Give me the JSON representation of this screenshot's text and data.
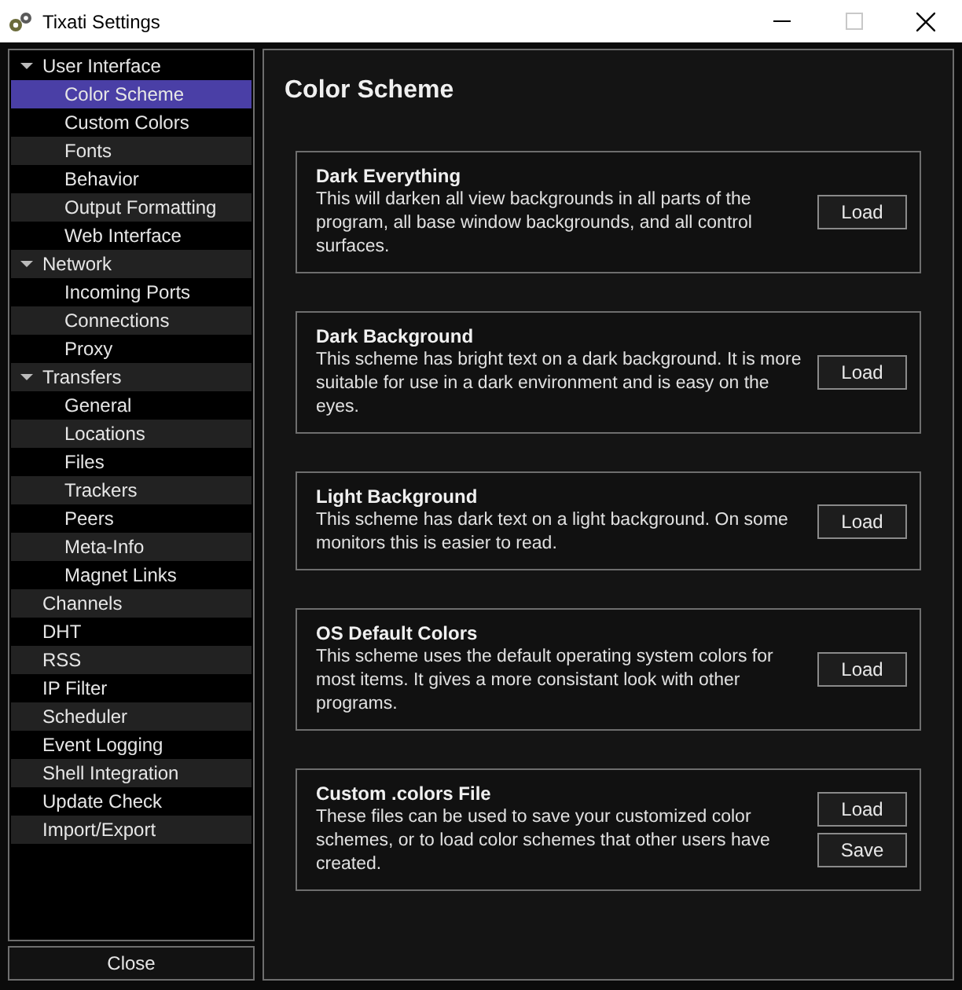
{
  "window": {
    "title": "Tixati Settings"
  },
  "sidebar": {
    "items": [
      {
        "label": "User Interface",
        "expanded": true,
        "selected": false,
        "children": [
          {
            "label": "Color Scheme",
            "selected": true
          },
          {
            "label": "Custom Colors",
            "selected": false
          },
          {
            "label": "Fonts",
            "selected": false
          },
          {
            "label": "Behavior",
            "selected": false
          },
          {
            "label": "Output Formatting",
            "selected": false
          },
          {
            "label": "Web Interface",
            "selected": false
          }
        ]
      },
      {
        "label": "Network",
        "expanded": true,
        "selected": false,
        "children": [
          {
            "label": "Incoming Ports",
            "selected": false
          },
          {
            "label": "Connections",
            "selected": false
          },
          {
            "label": "Proxy",
            "selected": false
          }
        ]
      },
      {
        "label": "Transfers",
        "expanded": true,
        "selected": false,
        "children": [
          {
            "label": "General",
            "selected": false
          },
          {
            "label": "Locations",
            "selected": false
          },
          {
            "label": "Files",
            "selected": false
          },
          {
            "label": "Trackers",
            "selected": false
          },
          {
            "label": "Peers",
            "selected": false
          },
          {
            "label": "Meta-Info",
            "selected": false
          },
          {
            "label": "Magnet Links",
            "selected": false
          }
        ]
      },
      {
        "label": "Channels",
        "selected": false
      },
      {
        "label": "DHT",
        "selected": false
      },
      {
        "label": "RSS",
        "selected": false
      },
      {
        "label": "IP Filter",
        "selected": false
      },
      {
        "label": "Scheduler",
        "selected": false
      },
      {
        "label": "Event Logging",
        "selected": false
      },
      {
        "label": "Shell Integration",
        "selected": false
      },
      {
        "label": "Update Check",
        "selected": false
      },
      {
        "label": "Import/Export",
        "selected": false
      }
    ],
    "close_button": "Close"
  },
  "main": {
    "heading": "Color Scheme",
    "schemes": [
      {
        "title": "Dark Everything",
        "description": "This will darken all view backgrounds in all parts of the program, all base window backgrounds, and all control surfaces.",
        "buttons": [
          "Load"
        ]
      },
      {
        "title": "Dark Background",
        "description": "This scheme has bright text on a dark background.  It is more suitable for use in a dark environment and is easy on the eyes.",
        "buttons": [
          "Load"
        ]
      },
      {
        "title": "Light Background",
        "description": "This scheme has dark text on a light background.  On some monitors this is easier to read.",
        "buttons": [
          "Load"
        ]
      },
      {
        "title": "OS Default Colors",
        "description": "This scheme uses the default operating system colors for most items.  It gives a more consistant look with other programs.",
        "buttons": [
          "Load"
        ]
      },
      {
        "title": "Custom .colors File",
        "description": "These files can be used to save your customized color schemes, or to load color schemes that other users have created.",
        "buttons": [
          "Load",
          "Save"
        ]
      }
    ]
  }
}
